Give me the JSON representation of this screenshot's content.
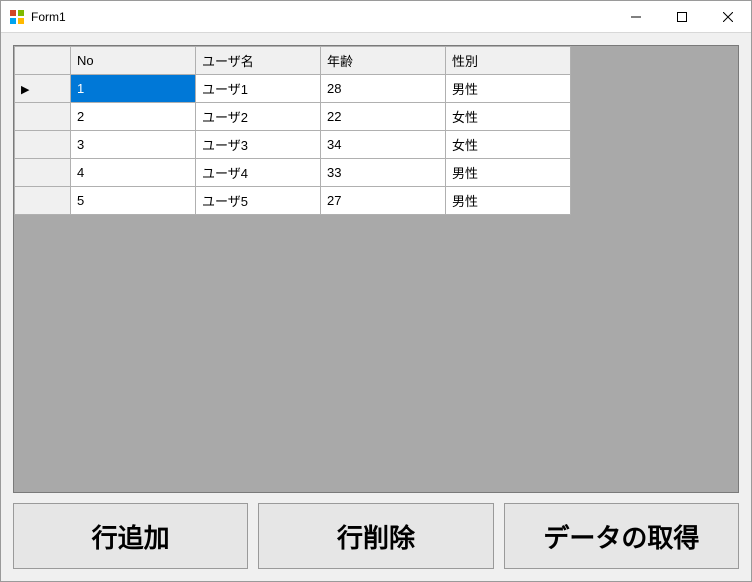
{
  "window": {
    "title": "Form1"
  },
  "grid": {
    "headers": {
      "no": "No",
      "user": "ユーザ名",
      "age": "年齢",
      "sex": "性別"
    },
    "rows": [
      {
        "no": "1",
        "user": "ユーザ1",
        "age": "28",
        "sex": "男性",
        "current": true
      },
      {
        "no": "2",
        "user": "ユーザ2",
        "age": "22",
        "sex": "女性",
        "current": false
      },
      {
        "no": "3",
        "user": "ユーザ3",
        "age": "34",
        "sex": "女性",
        "current": false
      },
      {
        "no": "4",
        "user": "ユーザ4",
        "age": "33",
        "sex": "男性",
        "current": false
      },
      {
        "no": "5",
        "user": "ユーザ5",
        "age": "27",
        "sex": "男性",
        "current": false
      }
    ],
    "selected": {
      "row": 0,
      "col": "no"
    }
  },
  "buttons": {
    "add": "行追加",
    "delete": "行削除",
    "fetch": "データの取得"
  }
}
